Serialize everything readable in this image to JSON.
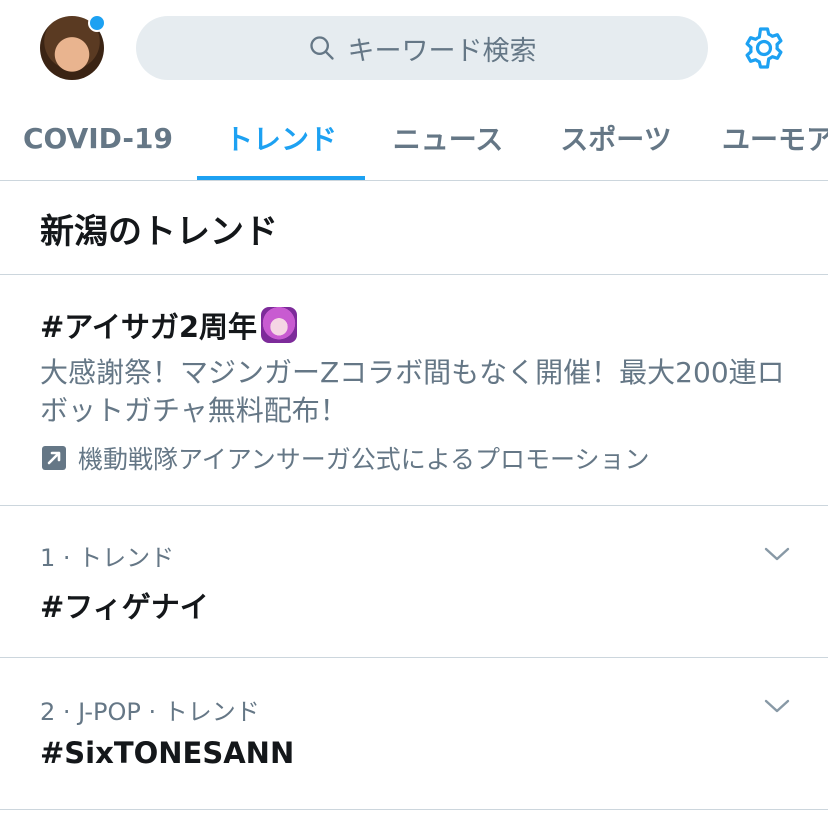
{
  "search": {
    "placeholder": "キーワード検索"
  },
  "tabs": [
    {
      "label": "COVID-19"
    },
    {
      "label": "トレンド"
    },
    {
      "label": "ニュース"
    },
    {
      "label": "スポーツ"
    },
    {
      "label": "ユーモア"
    }
  ],
  "active_tab": "トレンド",
  "section": {
    "title": "新潟のトレンド"
  },
  "promoted": {
    "title": "#アイサガ2周年",
    "description": "大感謝祭！マジンガーZコラボ間もなく開催！最大200連ロボットガチャ無料配布！",
    "promoted_by": "機動戦隊アイアンサーガ公式によるプロモーション"
  },
  "trends": [
    {
      "meta": "1 · トレンド",
      "name": "#フィゲナイ"
    },
    {
      "meta": "2 · J-POP · トレンド",
      "name": "#SixTONESANN"
    }
  ],
  "colors": {
    "accent": "#1da1f2",
    "muted": "#657786",
    "divider": "#ccd6dd",
    "search_bg": "#e6ecf0"
  },
  "icons": [
    "avatar",
    "search-icon",
    "gear-icon",
    "promoted-icon",
    "chevron-down-icon"
  ]
}
